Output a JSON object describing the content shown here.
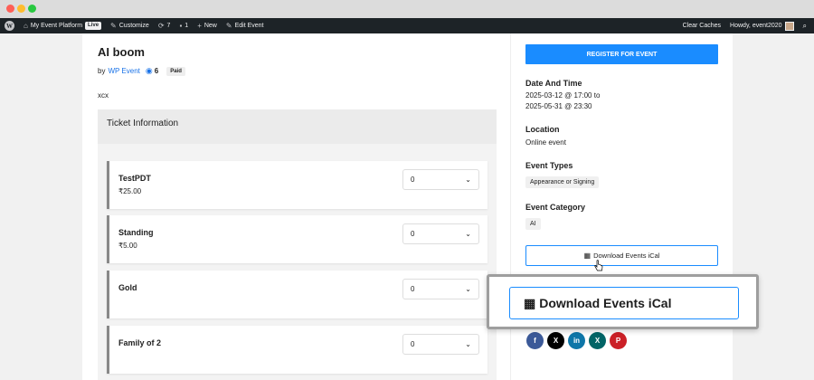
{
  "window": {
    "dots": [
      "close",
      "minimize",
      "maximize"
    ]
  },
  "adminbar": {
    "logo": "W",
    "site_name": "My Event Platform",
    "live_badge": "Live",
    "customize": "Customize",
    "updates_count": "7",
    "comments_count": "1",
    "new_label": "New",
    "edit_event": "Edit Event",
    "clear_caches": "Clear Caches",
    "howdy": "Howdy, event2020"
  },
  "event": {
    "title": "AI boom",
    "by_label": "by",
    "author": "WP Event",
    "views": "6",
    "paid_badge": "Paid",
    "description": "xcx"
  },
  "tickets": {
    "header": "Ticket Information",
    "items": [
      {
        "name": "TestPDT",
        "price": "₹25.00",
        "qty": "0"
      },
      {
        "name": "Standing",
        "price": "₹5.00",
        "qty": "0"
      },
      {
        "name": "Gold",
        "price": "",
        "qty": "0"
      },
      {
        "name": "Family of 2",
        "price": "",
        "qty": "0"
      }
    ]
  },
  "sidebar": {
    "register_button": "REGISTER FOR EVENT",
    "date_heading": "Date And Time",
    "date_line1": "2025-03-12 @ 17:00 to",
    "date_line2": "2025-05-31 @ 23:30",
    "location_heading": "Location",
    "location_value": "Online event",
    "types_heading": "Event Types",
    "type_chip": "Appearance or Signing",
    "category_heading": "Event Category",
    "category_chip": "AI",
    "ical_button": "Download Events iCal"
  },
  "socials": [
    {
      "name": "facebook",
      "glyph": "f",
      "color": "#3b5998"
    },
    {
      "name": "x",
      "glyph": "X",
      "color": "#000000"
    },
    {
      "name": "linkedin",
      "glyph": "in",
      "color": "#0e76a8"
    },
    {
      "name": "xing",
      "glyph": "X",
      "color": "#026466"
    },
    {
      "name": "pinterest",
      "glyph": "P",
      "color": "#cb2027"
    }
  ],
  "zoom_callout": {
    "label": "Download Events iCal"
  }
}
